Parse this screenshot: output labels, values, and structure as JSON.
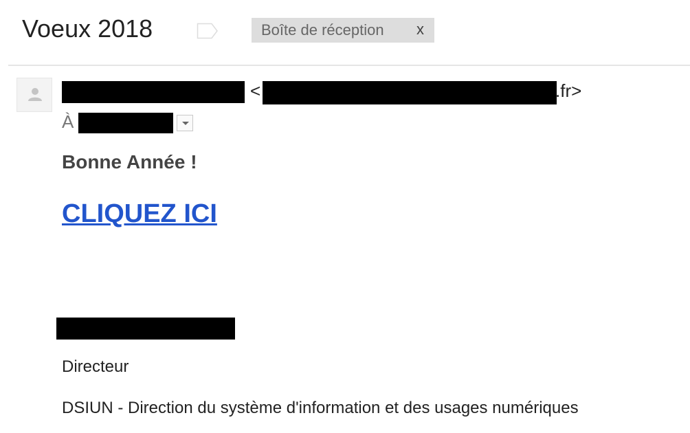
{
  "email": {
    "subject": "Voeux 2018",
    "label_chip": {
      "label": "Boîte de réception",
      "close_label": "x"
    },
    "sender": {
      "email_open": "<",
      "email_suffix": ".fr>"
    },
    "recipient": {
      "to_label": "À"
    },
    "body": {
      "greeting": "Bonne Année !",
      "link_text": "CLIQUEZ ICI"
    },
    "signature": {
      "title": "Directeur",
      "organization": "DSIUN - Direction du système d'information et des usages numériques"
    }
  },
  "icons": {
    "label": "label-tag-icon",
    "avatar": "person-icon",
    "dropdown": "chevron-down-icon"
  },
  "colors": {
    "link": "#2255cc",
    "chip_background": "#dddddd"
  }
}
